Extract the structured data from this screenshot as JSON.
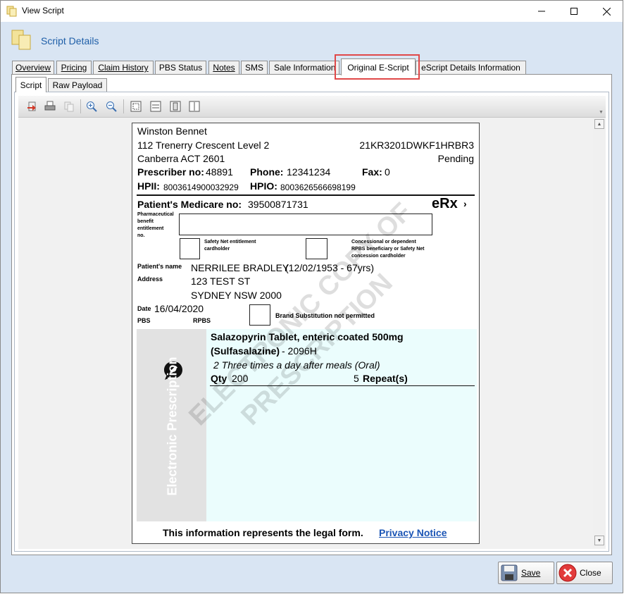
{
  "window": {
    "title": "View Script"
  },
  "header": {
    "title": "Script Details"
  },
  "tabs": [
    {
      "label": "Overview"
    },
    {
      "label": "Pricing"
    },
    {
      "label": "Claim History"
    },
    {
      "label": "PBS Status"
    },
    {
      "label": "Notes"
    },
    {
      "label": "SMS"
    },
    {
      "label": "Sale Information"
    },
    {
      "label": "Original E-Script"
    },
    {
      "label": "eScript Details Information"
    }
  ],
  "active_tab": "Original E-Script",
  "subtabs": [
    {
      "label": "Script"
    },
    {
      "label": "Raw Payload"
    }
  ],
  "prescription": {
    "prescriber_name": "Winston Bennet",
    "address_line1": "112 Trenerry Crescent Level 2",
    "address_line2": "Canberra ACT 2601",
    "script_id": "21KR3201DWKF1HRBR3",
    "status": "Pending",
    "prescriber_no_label": "Prescriber no:",
    "prescriber_no": "48891",
    "phone_label": "Phone:",
    "phone": "12341234",
    "fax_label": "Fax:",
    "fax": "0",
    "hpii_label": "HPII:",
    "hpii": "8003614900032929",
    "hpio_label": "HPIO:",
    "hpio": "8003626566698199",
    "medicare_label": "Patient's Medicare no:",
    "medicare_no": "39500871731",
    "erx_logo": "eRx",
    "pbe_label_1": "Pharmaceutical",
    "pbe_label_2": "benefit",
    "pbe_label_3": "entitlement",
    "pbe_label_4": "no.",
    "safety_net_label_1": "Safety Net entitlement",
    "safety_net_label_2": "cardholder",
    "concessional_label_1": "Concessional or dependent",
    "concessional_label_2": "RPBS beneficiary or Safety Net",
    "concessional_label_3": "concession cardholder",
    "patient_name_label": "Patient's name",
    "patient_name": "NERRILEE BRADLEY",
    "patient_dob": "(12/02/1953 - 67yrs)",
    "address_label": "Address",
    "patient_address1": "123 TEST ST",
    "patient_address2": "SYDNEY NSW 2000",
    "date_label": "Date",
    "date": "16/04/2020",
    "pbs_label": "PBS",
    "rpbs_label": "RPBS",
    "brand_sub_label": "Brand Substitution not permitted",
    "side_label": "Electronic Prescription",
    "drug_name": "Salazopyrin Tablet, enteric coated 500mg",
    "drug_generic": "(Sulfasalazine)",
    "drug_code": "- 2096H",
    "directions": "2 Three times a day after meals (Oral)",
    "qty_label": "Qty",
    "qty": "200",
    "repeats": "5",
    "repeats_label": "Repeat(s)",
    "watermark_1": "ELECTRONIC COPY OF",
    "watermark_2": "PRESCRIPTION",
    "legal_text": "This information represents the legal form.",
    "privacy_link": "Privacy Notice"
  },
  "buttons": {
    "save": "Save",
    "close": "Close"
  },
  "colors": {
    "header_title": "#1f5fa8",
    "highlight_box": "#e04848",
    "drug_panel": "#ebfdfd",
    "link": "#1b55b5"
  }
}
